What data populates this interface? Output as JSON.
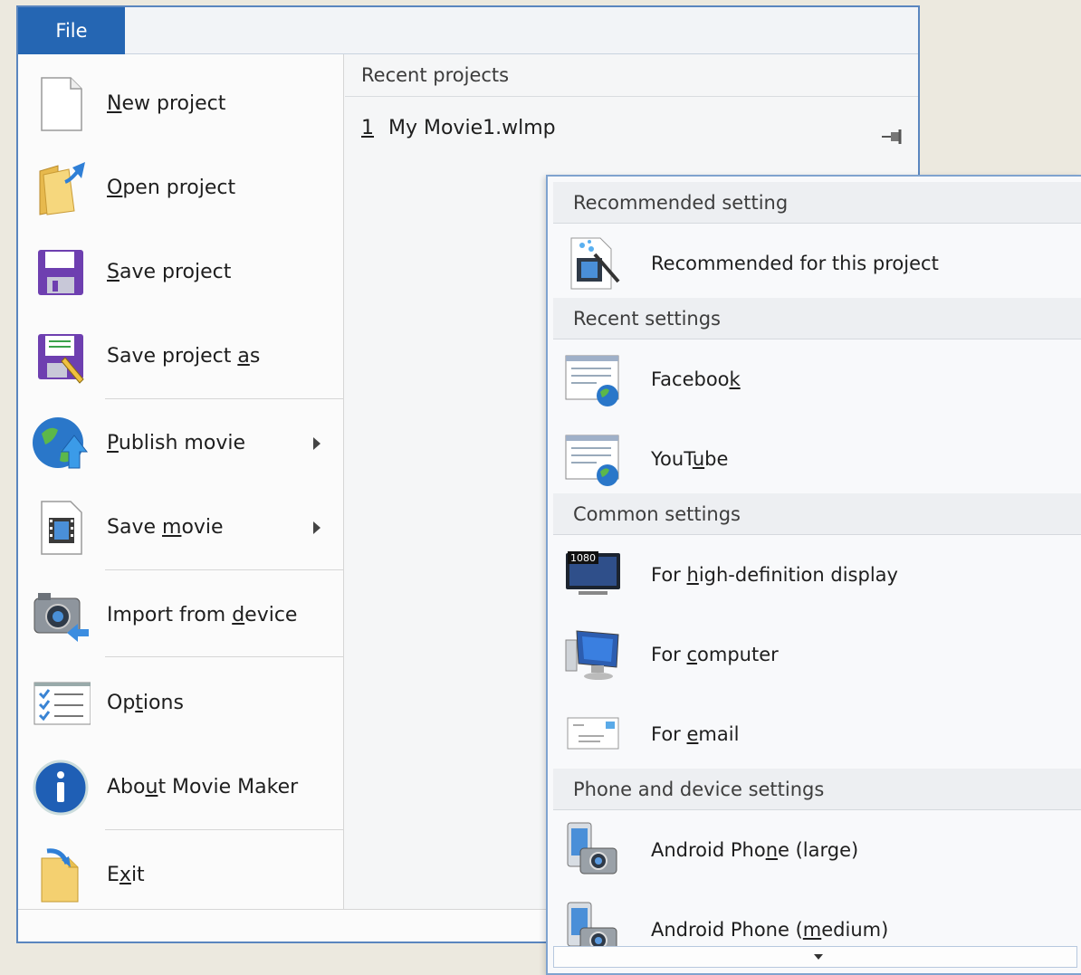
{
  "file_tab": "File",
  "menu": {
    "new_project": {
      "pre": "",
      "u": "N",
      "post": "ew project"
    },
    "open_project": {
      "pre": "",
      "u": "O",
      "post": "pen project"
    },
    "save_project": {
      "pre": "",
      "u": "S",
      "post": "ave project"
    },
    "save_project_as": {
      "pre": "Save project ",
      "u": "a",
      "post": "s"
    },
    "publish_movie": {
      "pre": "",
      "u": "P",
      "post": "ublish movie"
    },
    "save_movie": {
      "pre": "Save ",
      "u": "m",
      "post": "ovie"
    },
    "import_from_device": {
      "pre": "Import from ",
      "u": "d",
      "post": "evice"
    },
    "options": {
      "pre": "Op",
      "u": "t",
      "post": "ions"
    },
    "about": {
      "pre": "Abo",
      "u": "u",
      "post": "t Movie Maker"
    },
    "exit": {
      "pre": "E",
      "u": "x",
      "post": "it"
    }
  },
  "recent": {
    "header": "Recent projects",
    "items": [
      {
        "num": "1",
        "name": "My Movie1.wlmp"
      }
    ]
  },
  "submenu": {
    "sections": {
      "recommended": "Recommended setting",
      "recent": "Recent settings",
      "common": "Common settings",
      "phone": "Phone and device settings"
    },
    "items": {
      "recommended_project": {
        "pre": "Recommended for this pro",
        "u": "j",
        "post": "ect"
      },
      "facebook": {
        "pre": "Faceboo",
        "u": "k",
        "post": ""
      },
      "youtube": {
        "pre": "YouT",
        "u": "u",
        "post": "be"
      },
      "hd_display": {
        "pre": "For ",
        "u": "h",
        "post": "igh-definition display"
      },
      "computer": {
        "pre": "For ",
        "u": "c",
        "post": "omputer"
      },
      "email": {
        "pre": "For ",
        "u": "e",
        "post": "mail"
      },
      "android_large": {
        "pre": "Android Pho",
        "u": "n",
        "post": "e (large)"
      },
      "android_medium": {
        "pre": "Android Phone (",
        "u": "m",
        "post": "edium)"
      }
    },
    "hd_badge": "1080"
  },
  "colors": {
    "file_tab": "#2566b3",
    "window_border": "#5a86bf",
    "submenu_border": "#7fa3cf"
  },
  "icons": {
    "new_project": "blank-document-icon",
    "open_project": "open-folder-icon",
    "save_project": "floppy-disk-icon",
    "save_project_as": "floppy-disk-pencil-icon",
    "publish_movie": "globe-upload-icon",
    "save_movie": "film-document-icon",
    "import_from_device": "camera-import-icon",
    "options": "checklist-icon",
    "about": "info-icon",
    "exit": "exit-folder-icon"
  }
}
